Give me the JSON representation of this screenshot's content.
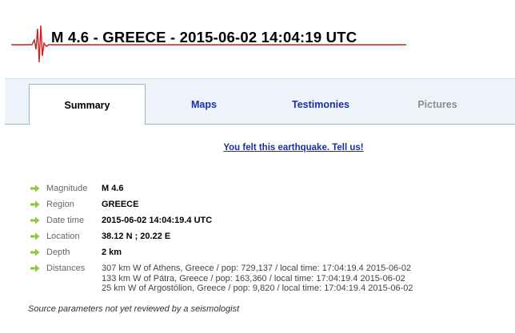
{
  "header": {
    "title": "M 4.6 - GREECE - 2015-06-02 14:04:19 UTC",
    "icon": "seismogram-icon",
    "accent_color": "#cc1f1f"
  },
  "tabs": [
    {
      "label": "Summary",
      "state": "active"
    },
    {
      "label": "Maps",
      "state": "link"
    },
    {
      "label": "Testimonies",
      "state": "link"
    },
    {
      "label": "Pictures",
      "state": "disabled"
    }
  ],
  "felt_link": "You felt this earthquake. Tell us!",
  "params": {
    "magnitude": {
      "label": "Magnitude",
      "value": "M 4.6"
    },
    "region": {
      "label": "Region",
      "value": "GREECE"
    },
    "datetime": {
      "label": "Date time",
      "value": "2015-06-02 14:04:19.4 UTC"
    },
    "location": {
      "label": "Location",
      "value": "38.12 N ; 20.22 E"
    },
    "depth": {
      "label": "Depth",
      "value": "2 km"
    },
    "distances": {
      "label": "Distances",
      "lines": [
        "307 km W of Athens, Greece / pop: 729,137 / local time: 17:04:19.4 2015-06-02",
        "133 km W of Pátra, Greece / pop: 163,360 / local time: 17:04:19.4 2015-06-02",
        "25 km W of Argostólion, Greece / pop: 9,820 / local time: 17:04:19.4 2015-06-02"
      ]
    }
  },
  "note": "Source parameters not yet reviewed by a seismologist",
  "colors": {
    "link": "#1b2fa3",
    "arrow": "#8dc63f",
    "tab_bg": "#eef3fa"
  }
}
